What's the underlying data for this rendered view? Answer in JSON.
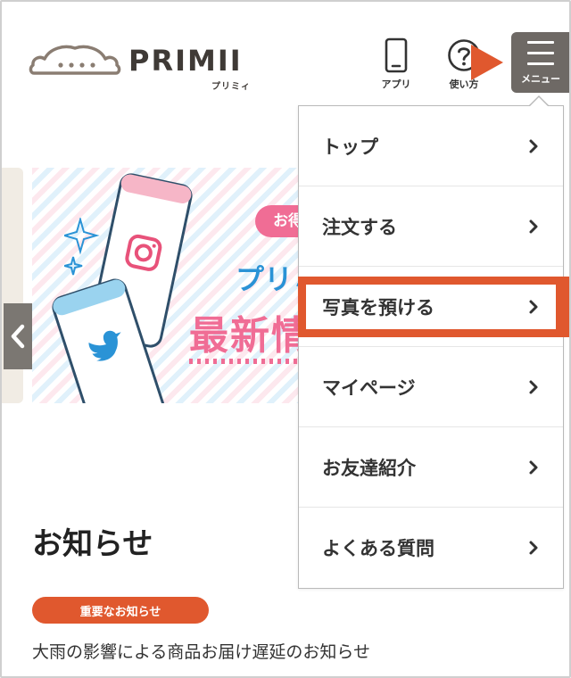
{
  "header": {
    "logo_text": "PRIMII",
    "logo_kana": "プリミィ",
    "app_label": "アプリ",
    "help_label": "使い方",
    "menu_label": "メニュー"
  },
  "banner": {
    "tag": "お得",
    "line1": "プリミ",
    "line2": "最新情"
  },
  "notices": {
    "title": "お知らせ",
    "badge": "重要なお知らせ",
    "items": [
      "大雨の影響による商品お届け遅延のお知らせ"
    ]
  },
  "menu": {
    "items": [
      {
        "label": "トップ"
      },
      {
        "label": "注文する"
      },
      {
        "label": "写真を預ける",
        "highlighted": true
      },
      {
        "label": "マイページ"
      },
      {
        "label": "お友達紹介"
      },
      {
        "label": "よくある質問"
      }
    ]
  },
  "colors": {
    "accent": "#e0582e",
    "menu_button": "#6e6965",
    "pink": "#f06d95",
    "blue": "#2a93d6"
  }
}
